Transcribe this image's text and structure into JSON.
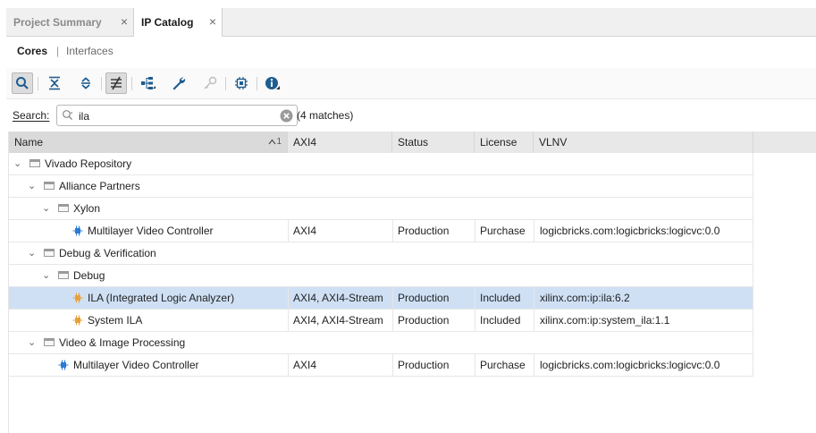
{
  "tabs": [
    {
      "label": "Project Summary"
    },
    {
      "label": "IP Catalog"
    }
  ],
  "tab_close_glyph": "×",
  "subnav": {
    "cores": "Cores",
    "separator": "|",
    "interfaces": "Interfaces"
  },
  "toolbar": {
    "icons": [
      "search-icon",
      "collapse-all-icon",
      "expand-all-icon",
      "filter-toggle-icon",
      "hierarchy-icon",
      "wrench-icon",
      "key-icon",
      "chip-icon",
      "info-icon"
    ]
  },
  "search": {
    "label": "Search:",
    "value": "ila",
    "matches": "(4 matches)"
  },
  "table": {
    "columns": {
      "name": "Name",
      "sort": "1",
      "axi4": "AXI4",
      "status": "Status",
      "license": "License",
      "vlnv": "VLNV"
    },
    "rows": [
      {
        "name": "Vivado Repository",
        "axi": "",
        "status": "",
        "license": "",
        "vlnv": ""
      },
      {
        "name": "Alliance Partners",
        "axi": "",
        "status": "",
        "license": "",
        "vlnv": ""
      },
      {
        "name": "Xylon",
        "axi": "",
        "status": "",
        "license": "",
        "vlnv": ""
      },
      {
        "name": "Multilayer Video Controller",
        "axi": "AXI4",
        "status": "Production",
        "license": "Purchase",
        "vlnv": "logicbricks.com:logicbricks:logicvc:0.0"
      },
      {
        "name": "Debug & Verification",
        "axi": "",
        "status": "",
        "license": "",
        "vlnv": ""
      },
      {
        "name": "Debug",
        "axi": "",
        "status": "",
        "license": "",
        "vlnv": ""
      },
      {
        "name": "ILA (Integrated Logic Analyzer)",
        "axi": "AXI4, AXI4-Stream",
        "status": "Production",
        "license": "Included",
        "vlnv": "xilinx.com:ip:ila:6.2"
      },
      {
        "name": "System ILA",
        "axi": "AXI4, AXI4-Stream",
        "status": "Production",
        "license": "Included",
        "vlnv": "xilinx.com:ip:system_ila:1.1"
      },
      {
        "name": "Video & Image Processing",
        "axi": "",
        "status": "",
        "license": "",
        "vlnv": ""
      },
      {
        "name": "Multilayer Video Controller",
        "axi": "AXI4",
        "status": "Production",
        "license": "Purchase",
        "vlnv": "logicbricks.com:logicbricks:logicvc:0.0"
      }
    ]
  },
  "colors": {
    "selected_row": "#cfe0f5",
    "toolbar_icon": "#1f5d8f",
    "ip_icon_blue": "#2b7bd3",
    "ip_icon_orange": "#e8a13a"
  }
}
